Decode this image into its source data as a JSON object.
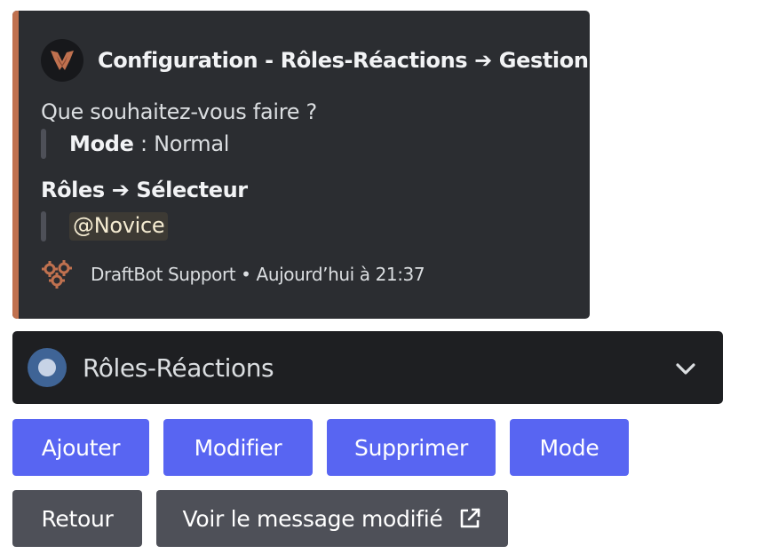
{
  "embed": {
    "accent_color": "#c0714f",
    "author": {
      "icon": "draftbot-logo-icon",
      "title": "Configuration - Rôles-Réactions ➔ Gestion"
    },
    "description": "Que souhaitez-vous faire ?",
    "mode": {
      "label": "Mode",
      "separator": " : ",
      "value": "Normal"
    },
    "field": {
      "title": "Rôles ➔ Sélecteur",
      "mention": "@Novice"
    },
    "footer": {
      "icon": "gears-icon",
      "text": "DraftBot Support • Aujourd’hui à 21:37"
    }
  },
  "select_menu": {
    "icon": "circle-icon",
    "value": "Rôles-Réactions",
    "chevron": "chevron-down-icon"
  },
  "buttons": {
    "row1": [
      {
        "label": "Ajouter",
        "style": "primary"
      },
      {
        "label": "Modifier",
        "style": "primary"
      },
      {
        "label": "Supprimer",
        "style": "primary"
      },
      {
        "label": "Mode",
        "style": "primary"
      }
    ],
    "row2": [
      {
        "label": "Retour",
        "style": "secondary"
      },
      {
        "label": "Voir le message modifié",
        "style": "secondary",
        "icon": "external-link-icon"
      }
    ]
  },
  "colors": {
    "blurple": "#5865f2",
    "secondary": "#4e5058",
    "embed_bg": "#2b2d31",
    "select_bg": "#1e1f22"
  }
}
